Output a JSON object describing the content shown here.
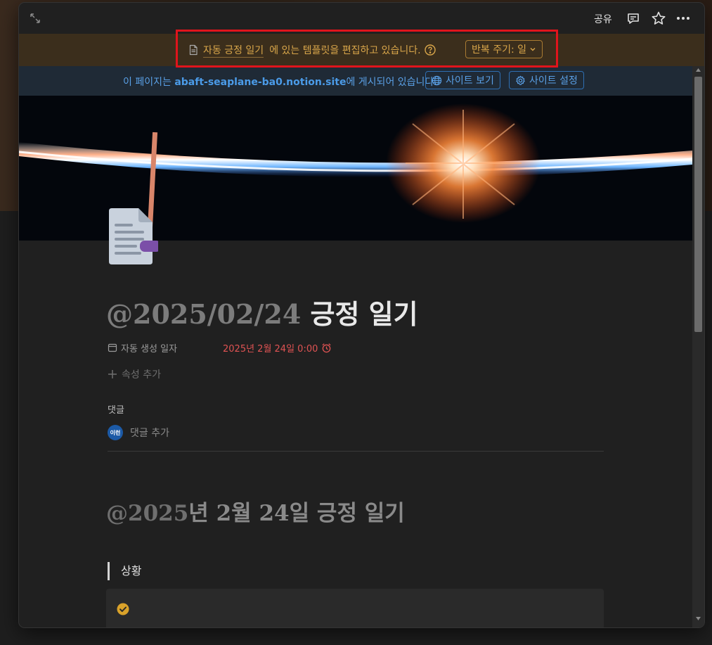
{
  "topbar": {
    "share_label": "공유",
    "icons": [
      "expand-icon",
      "comment-icon",
      "star-icon",
      "more-icon"
    ]
  },
  "template_banner": {
    "template_link": "자동 긍정 일기",
    "message": "에 있는 템플릿을 편집하고 있습니다.",
    "repeat_label": "반복 주기: 일",
    "accent_color": "#d9a64a",
    "background_color": "#3b2e1c",
    "highlight_color": "#e0141c"
  },
  "publish_banner": {
    "text_prefix": "이 페이지는 ",
    "site": "abaft-seaplane-ba0.notion.site",
    "text_suffix": "에 게시되어 있습니다.",
    "view_site_label": "사이트 보기",
    "site_settings_label": "사이트 설정",
    "accent_color": "#5aa0e6"
  },
  "page": {
    "title_mention": "@2025/02/24",
    "title_text": " 긍정 일기",
    "properties": [
      {
        "label": "자동 생성 일자",
        "value": "2025년 2월 24일 0:00"
      }
    ],
    "add_property_label": "속성 추가",
    "comments_title": "댓글",
    "avatar_initials": "이런",
    "add_comment_label": "댓글 추가",
    "heading_mention": "@2025",
    "heading_rest": "년 2월 24일 긍정 일기",
    "quote_text": "상황",
    "date_color": "#e05353",
    "check_color": "#d9a22a"
  }
}
